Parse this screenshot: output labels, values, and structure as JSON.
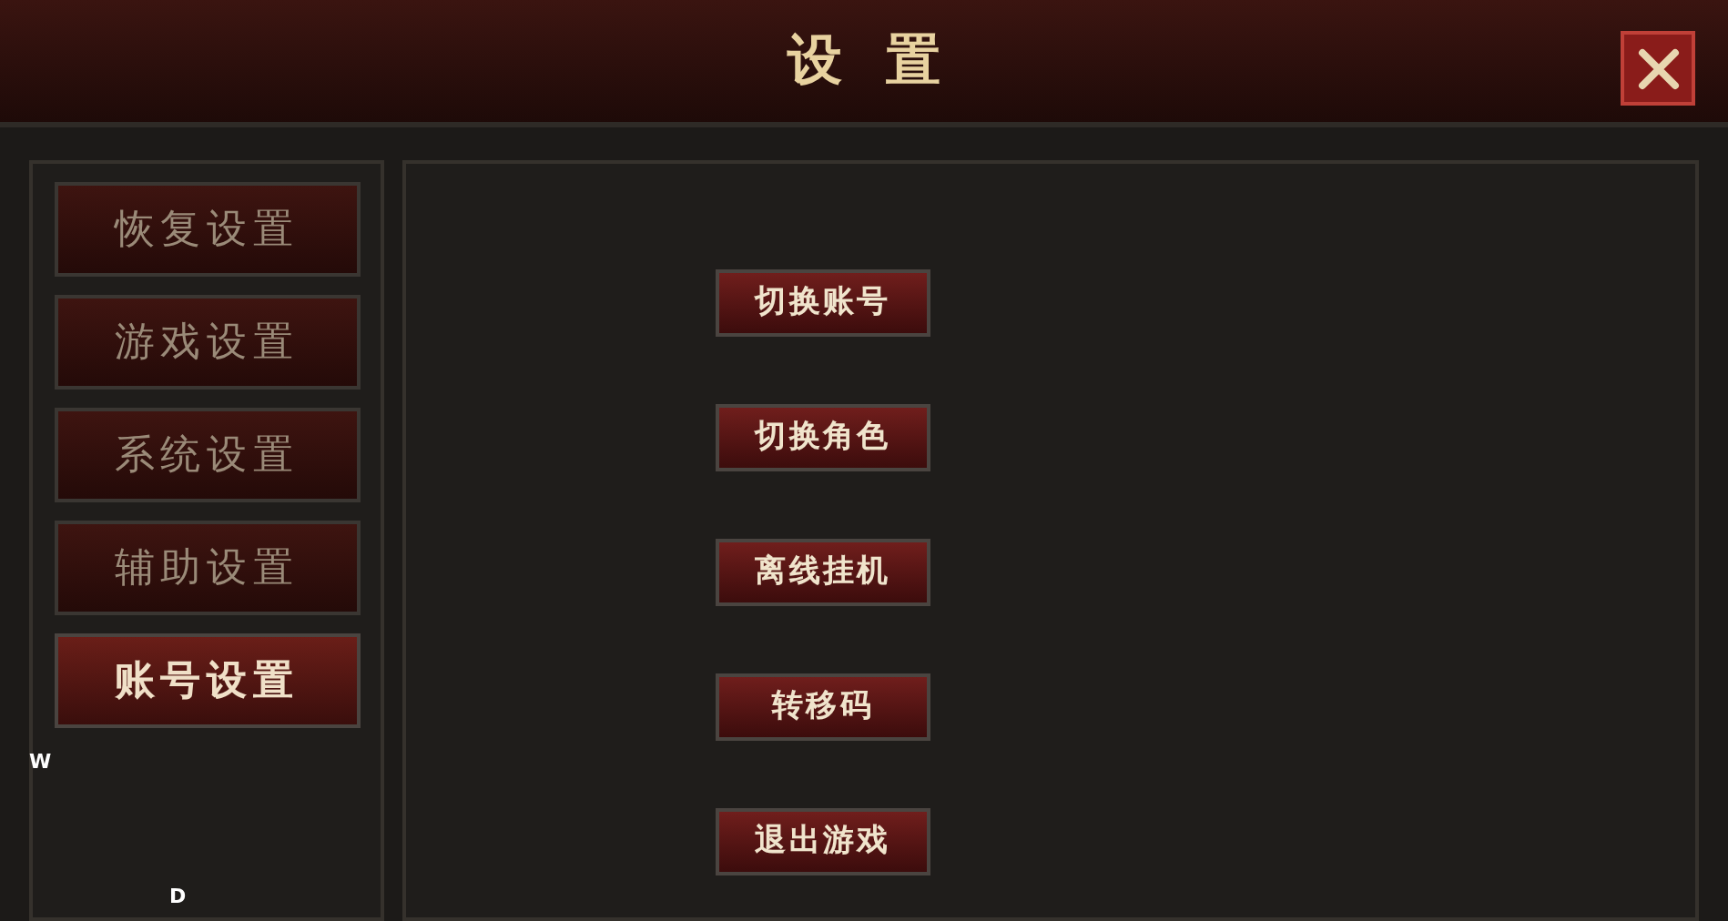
{
  "window": {
    "title": "设置"
  },
  "tabs": [
    {
      "label": "恢复设置",
      "selected": false
    },
    {
      "label": "游戏设置",
      "selected": false
    },
    {
      "label": "系统设置",
      "selected": false
    },
    {
      "label": "辅助设置",
      "selected": false
    },
    {
      "label": "账号设置",
      "selected": true
    }
  ],
  "buttons": [
    "切换账号",
    "切换角色",
    "离线挂机",
    "转移码",
    "退出游戏"
  ],
  "key_hints": [
    "W",
    "D"
  ]
}
